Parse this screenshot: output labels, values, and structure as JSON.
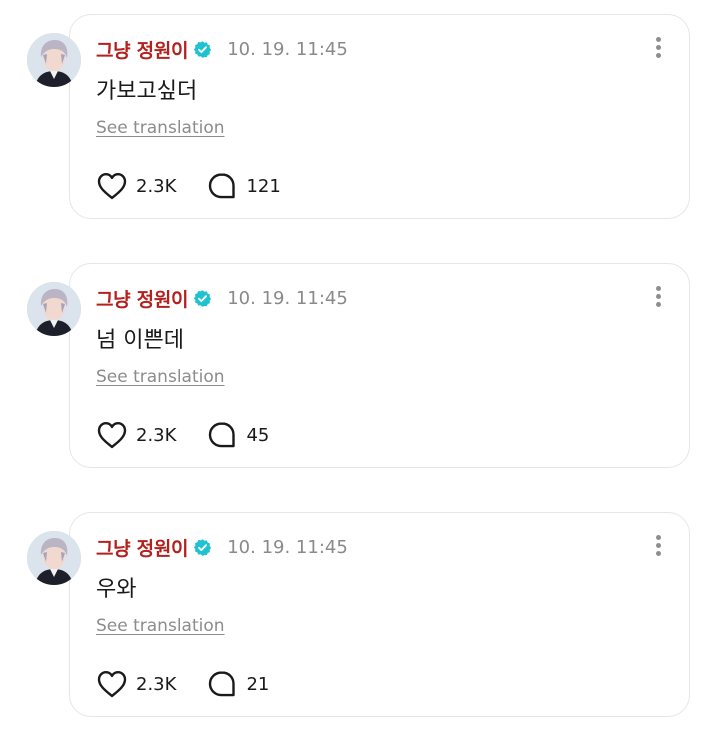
{
  "posts": [
    {
      "username": "그냥 정원이",
      "timestamp": "10. 19. 11:45",
      "text": "가보고싶더",
      "see_translation": "See translation",
      "likes": "2.3K",
      "comments": "121"
    },
    {
      "username": "그냥 정원이",
      "timestamp": "10. 19. 11:45",
      "text": "넘 이쁜데",
      "see_translation": "See translation",
      "likes": "2.3K",
      "comments": "45"
    },
    {
      "username": "그냥 정원이",
      "timestamp": "10. 19. 11:45",
      "text": "우와",
      "see_translation": "See translation",
      "likes": "2.3K",
      "comments": "21"
    }
  ],
  "colors": {
    "username": "#b3211e",
    "verified": "#1ec2d0",
    "timestamp": "#8a8a8a",
    "card_border": "#e6e6e6"
  },
  "icons": {
    "verified": "verified-badge-icon",
    "more": "more-vertical-icon",
    "like": "heart-icon",
    "comment": "comment-bubble-icon"
  }
}
